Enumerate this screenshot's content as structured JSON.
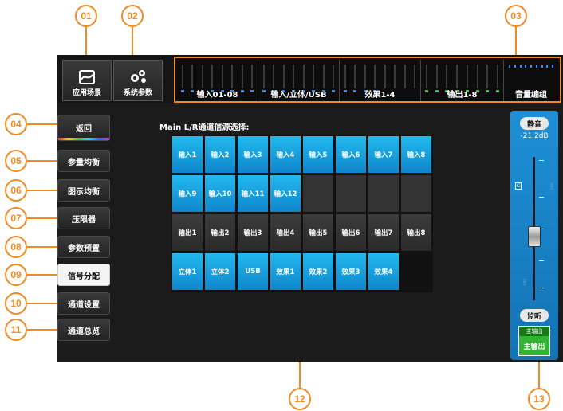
{
  "callouts": [
    "01",
    "02",
    "03",
    "04",
    "05",
    "06",
    "07",
    "08",
    "09",
    "10",
    "11",
    "12",
    "13"
  ],
  "topbar": {
    "scene_label": "应用场景",
    "system_label": "系统参数",
    "meter_groups": [
      {
        "label": "输入01-08",
        "dot_color": "#2b8cff"
      },
      {
        "label": "输入/立体/USB",
        "dot_color": "#2b8cff"
      },
      {
        "label": "效果1-4",
        "dot_color": "#2b8cff"
      },
      {
        "label": "输出1-8",
        "dot_color": "#2ecc40"
      },
      {
        "label": "音量编组",
        "dot_color": "#2b8cff"
      }
    ]
  },
  "nav": {
    "back": "返回",
    "items": [
      "参量均衡",
      "图示均衡",
      "压限器",
      "参数预置",
      "信号分配",
      "通道设置",
      "通道总览"
    ],
    "active_index": 4
  },
  "main": {
    "title": "Main L/R通道信源选择:",
    "row1": [
      "输入1",
      "输入2",
      "输入3",
      "输入4",
      "输入5",
      "输入6",
      "输入7",
      "输入8"
    ],
    "row2": [
      "输入9",
      "输入10",
      "输入11",
      "输入12"
    ],
    "row3": [
      "输出1",
      "输出2",
      "输出3",
      "输出4",
      "输出5",
      "输出6",
      "输出7",
      "输出8"
    ],
    "row4": [
      "立体1",
      "立体2",
      "USB",
      "效果1",
      "效果2",
      "效果3",
      "效果4"
    ]
  },
  "fader": {
    "mute_label": "静音",
    "level": "-21.2dB",
    "c_marker": "C",
    "monitor_label": "监听",
    "output_top": "主输出",
    "output_main": "主输出"
  },
  "colors": {
    "accent": "#f08a24",
    "active_cell": "#17a2e4",
    "fader_strip": "#1a82c8",
    "output_green": "#33b333"
  }
}
